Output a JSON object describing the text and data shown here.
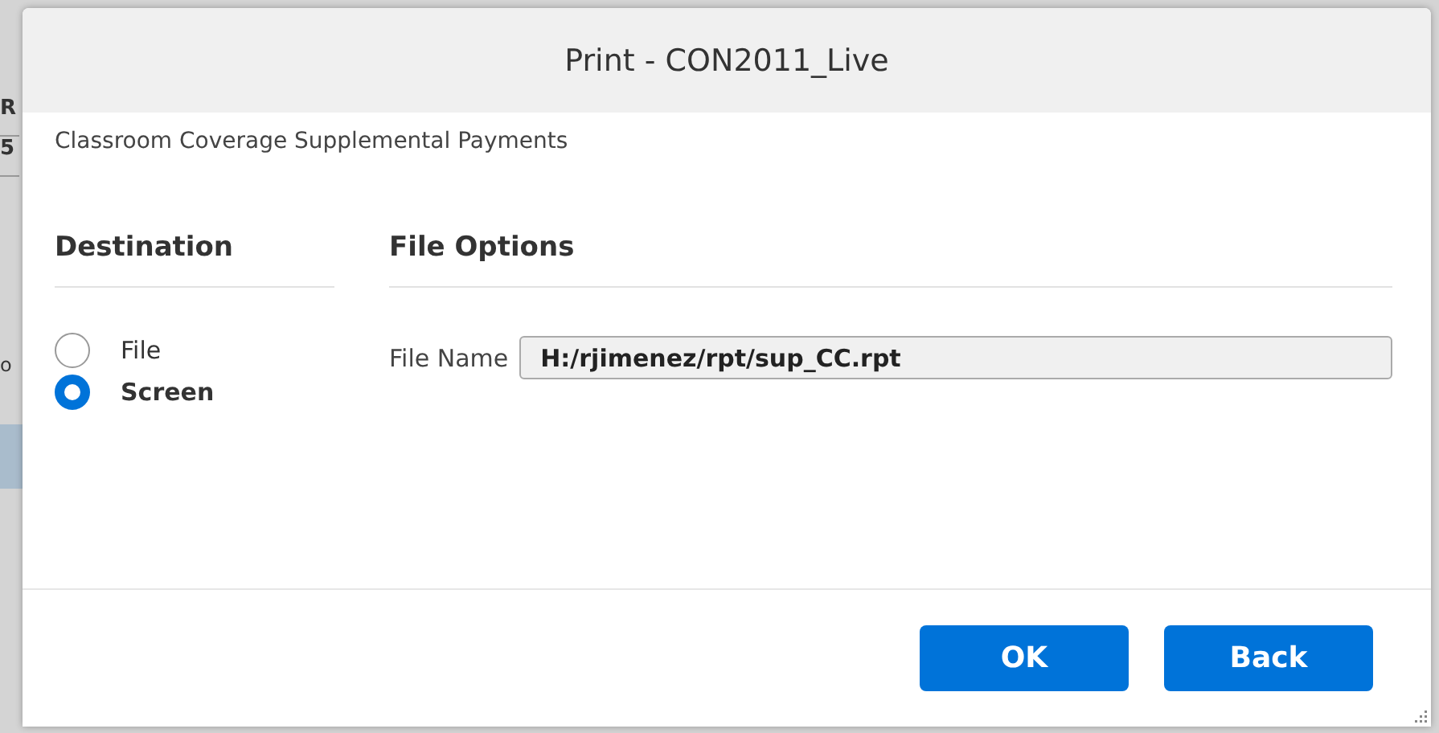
{
  "background": {
    "fragments": [
      "R",
      "5",
      "o"
    ]
  },
  "dialog": {
    "title": "Print - CON2011_Live",
    "subtitle": "Classroom Coverage Supplemental Payments",
    "destination": {
      "heading": "Destination",
      "options": [
        {
          "label": "File",
          "selected": false
        },
        {
          "label": "Screen",
          "selected": true
        }
      ]
    },
    "file_options": {
      "heading": "File Options",
      "file_name": {
        "label": "File Name",
        "value": "H:/rjimenez/rpt/sup_CC.rpt"
      }
    },
    "buttons": [
      "OK",
      "Back"
    ]
  }
}
